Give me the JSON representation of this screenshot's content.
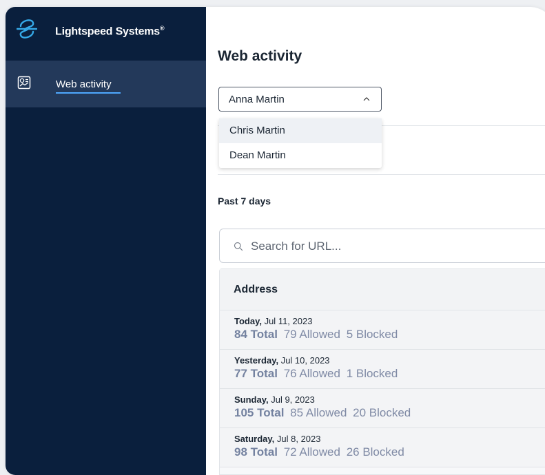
{
  "brand": {
    "name": "Lightspeed Systems",
    "reg": "®"
  },
  "sidebar": {
    "items": [
      {
        "label": "Web activity",
        "icon": "report-icon",
        "active": true
      }
    ]
  },
  "main": {
    "title": "Web activity",
    "user_select": {
      "selected": "Anna Martin",
      "options": [
        "Chris Martin",
        "Dean Martin"
      ]
    },
    "period": "Past 7 days",
    "search": {
      "placeholder": "Search for URL...",
      "value": ""
    },
    "table": {
      "header": "Address",
      "rows": [
        {
          "day": "Today,",
          "date": " Jul 11, 2023",
          "total": "84 Total",
          "allowed": "79 Allowed",
          "blocked": "5 Blocked"
        },
        {
          "day": "Yesterday,",
          "date": " Jul 10, 2023",
          "total": "77 Total",
          "allowed": "76 Allowed",
          "blocked": "1 Blocked"
        },
        {
          "day": "Sunday,",
          "date": " Jul 9, 2023",
          "total": "105 Total",
          "allowed": "85 Allowed",
          "blocked": "20 Blocked"
        },
        {
          "day": "Saturday,",
          "date": " Jul 8, 2023",
          "total": "98 Total",
          "allowed": "72 Allowed",
          "blocked": "26 Blocked"
        }
      ]
    }
  },
  "colors": {
    "sidebar": "#0a1f3d",
    "sidebar_active": "#23395a",
    "accent": "#4fa9ff",
    "stat_text": "#7f8aa5"
  }
}
